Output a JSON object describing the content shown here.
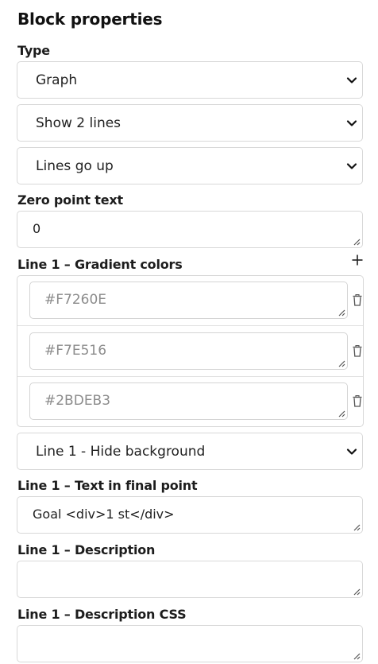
{
  "heading": "Block properties",
  "type_label": "Type",
  "selects": {
    "type": "Graph",
    "lines": "Show 2 lines",
    "direction": "Lines go up",
    "line1_background": "Line 1 - Hide background"
  },
  "zero_point": {
    "label": "Zero point text",
    "value": "0"
  },
  "gradient": {
    "label": "Line 1 – Gradient colors",
    "colors": [
      "#F7260E",
      "#F7E516",
      "#2BDEB3"
    ]
  },
  "final_point": {
    "label": "Line 1 – Text in final point",
    "value": "Goal <div>1 st</div>"
  },
  "description": {
    "label": "Line 1 – Description",
    "value": ""
  },
  "description_css": {
    "label": "Line 1 – Description CSS",
    "value": ""
  },
  "icons": {
    "dropdown": "chevron-down-icon",
    "add": "plus-icon",
    "delete": "trash-icon",
    "resize": "resize-grip-icon"
  }
}
